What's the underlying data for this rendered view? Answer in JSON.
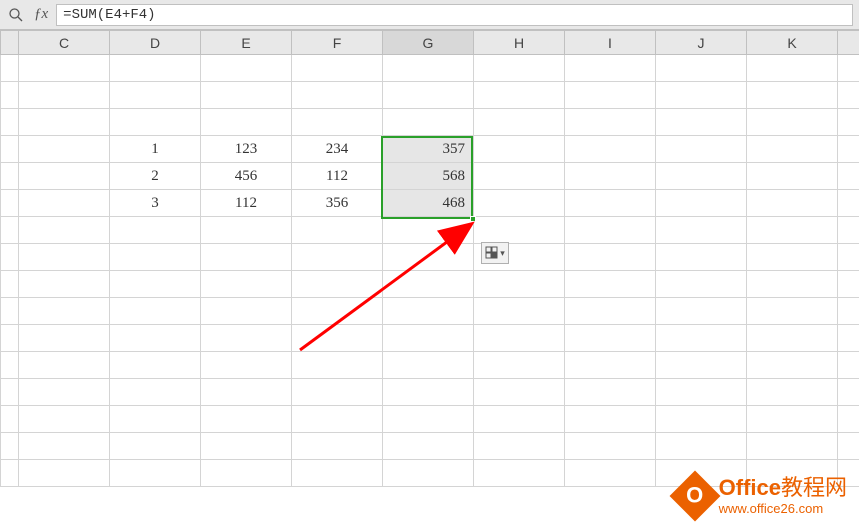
{
  "formula_bar": {
    "formula": "=SUM(E4+F4)"
  },
  "columns": [
    "C",
    "D",
    "E",
    "F",
    "G",
    "H",
    "I",
    "J",
    "K"
  ],
  "selected_column_index": 4,
  "rows": [
    {
      "D": "",
      "E": "",
      "F": "",
      "G": ""
    },
    {
      "D": "",
      "E": "",
      "F": "",
      "G": ""
    },
    {
      "D": "",
      "E": "",
      "F": "",
      "G": ""
    },
    {
      "D": "1",
      "E": "123",
      "F": "234",
      "G": "357"
    },
    {
      "D": "2",
      "E": "456",
      "F": "112",
      "G": "568"
    },
    {
      "D": "3",
      "E": "112",
      "F": "356",
      "G": "468"
    },
    {
      "D": "",
      "E": "",
      "F": "",
      "G": ""
    },
    {
      "D": "",
      "E": "",
      "F": "",
      "G": ""
    },
    {
      "D": "",
      "E": "",
      "F": "",
      "G": ""
    },
    {
      "D": "",
      "E": "",
      "F": "",
      "G": ""
    },
    {
      "D": "",
      "E": "",
      "F": "",
      "G": ""
    },
    {
      "D": "",
      "E": "",
      "F": "",
      "G": ""
    },
    {
      "D": "",
      "E": "",
      "F": "",
      "G": ""
    },
    {
      "D": "",
      "E": "",
      "F": "",
      "G": ""
    },
    {
      "D": "",
      "E": "",
      "F": "",
      "G": ""
    },
    {
      "D": "",
      "E": "",
      "F": "",
      "G": ""
    }
  ],
  "selection": {
    "col": "G",
    "rows_visual": [
      3,
      5
    ]
  },
  "watermark": {
    "brand_en": "Office",
    "brand_cn": "教程网",
    "url": "www.office26.com",
    "icon_letter": "O"
  }
}
